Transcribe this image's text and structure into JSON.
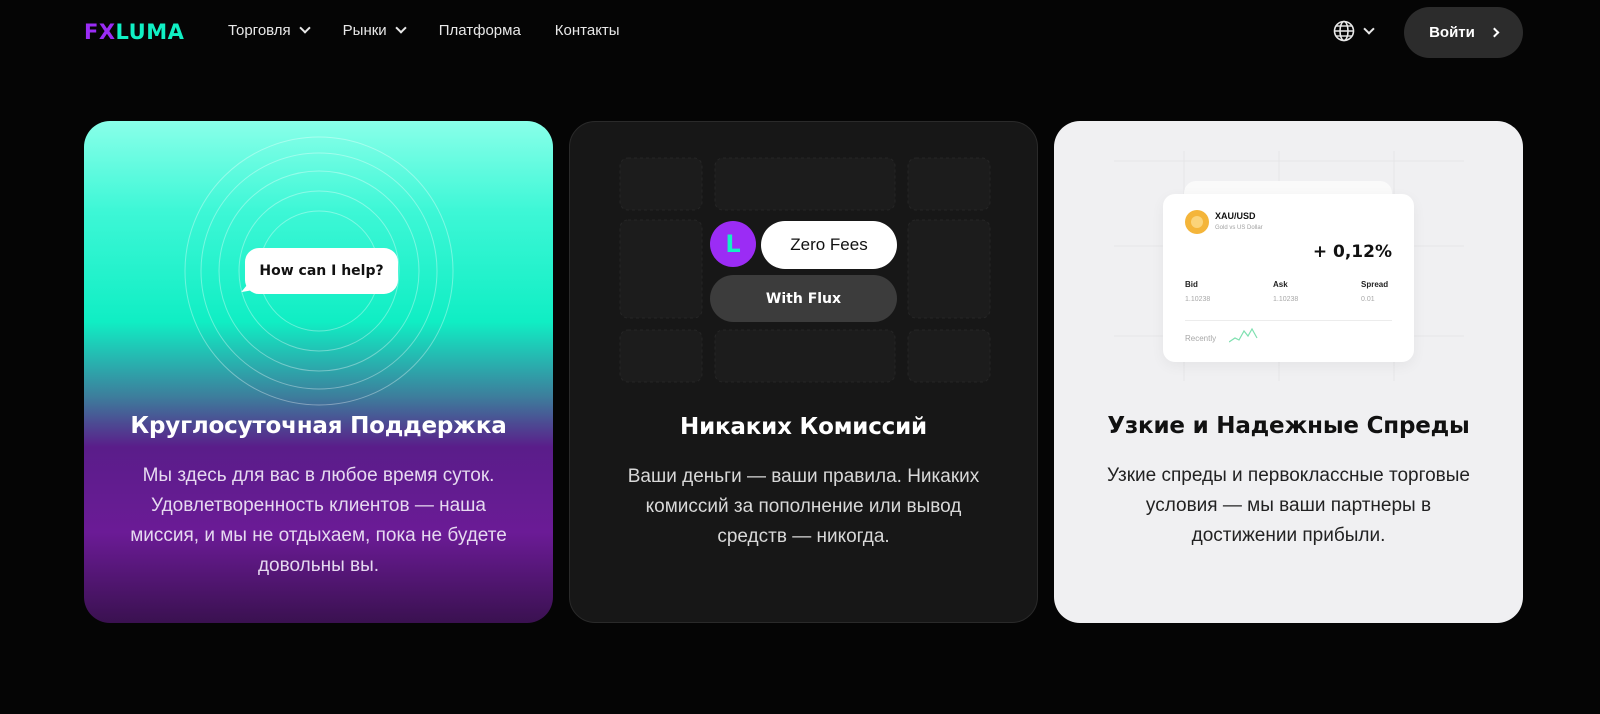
{
  "header": {
    "logo_fx": "FX",
    "logo_luma": "LUMA",
    "nav": [
      {
        "label": "Торговля",
        "has_dropdown": true
      },
      {
        "label": "Рынки",
        "has_dropdown": true
      },
      {
        "label": "Платформа",
        "has_dropdown": false
      },
      {
        "label": "Контакты",
        "has_dropdown": false
      }
    ],
    "language_icon": "globe-icon",
    "login_label": "Войти"
  },
  "cards": [
    {
      "title": "Круглосуточная Поддержка",
      "description": "Мы здесь для вас в любое время суток. Удовлетворенность клиентов — наша миссия, и мы не отдыхаем, пока не будете довольны вы.",
      "bubble_text": "How can I help?"
    },
    {
      "title": "Никаких Комиссий",
      "description": "Ваши деньги — ваши правила. Никаких комиссий за пополнение или вывод средств — никогда.",
      "avatar_letter": "L",
      "pill_zero": "Zero Fees",
      "pill_flux": "With Flux"
    },
    {
      "title": "Узкие и Надежные Спреды",
      "description": "Узкие спреды и первоклассные торговые условия — мы ваши партнеры в достижении прибыли.",
      "quote": {
        "pair": "XAU/USD",
        "pair_subtitle": "Gold vs US Dollar",
        "change": "+ 0,12%",
        "bid_label": "Bid",
        "bid_value": "1.10238",
        "ask_label": "Ask",
        "ask_value": "1.10238",
        "spread_label": "Spread",
        "spread_value": "0.01",
        "recent_label": "Recently"
      }
    }
  ],
  "colors": {
    "brand_purple": "#9a2cf5",
    "brand_teal": "#10f0c4",
    "background": "#050505"
  }
}
